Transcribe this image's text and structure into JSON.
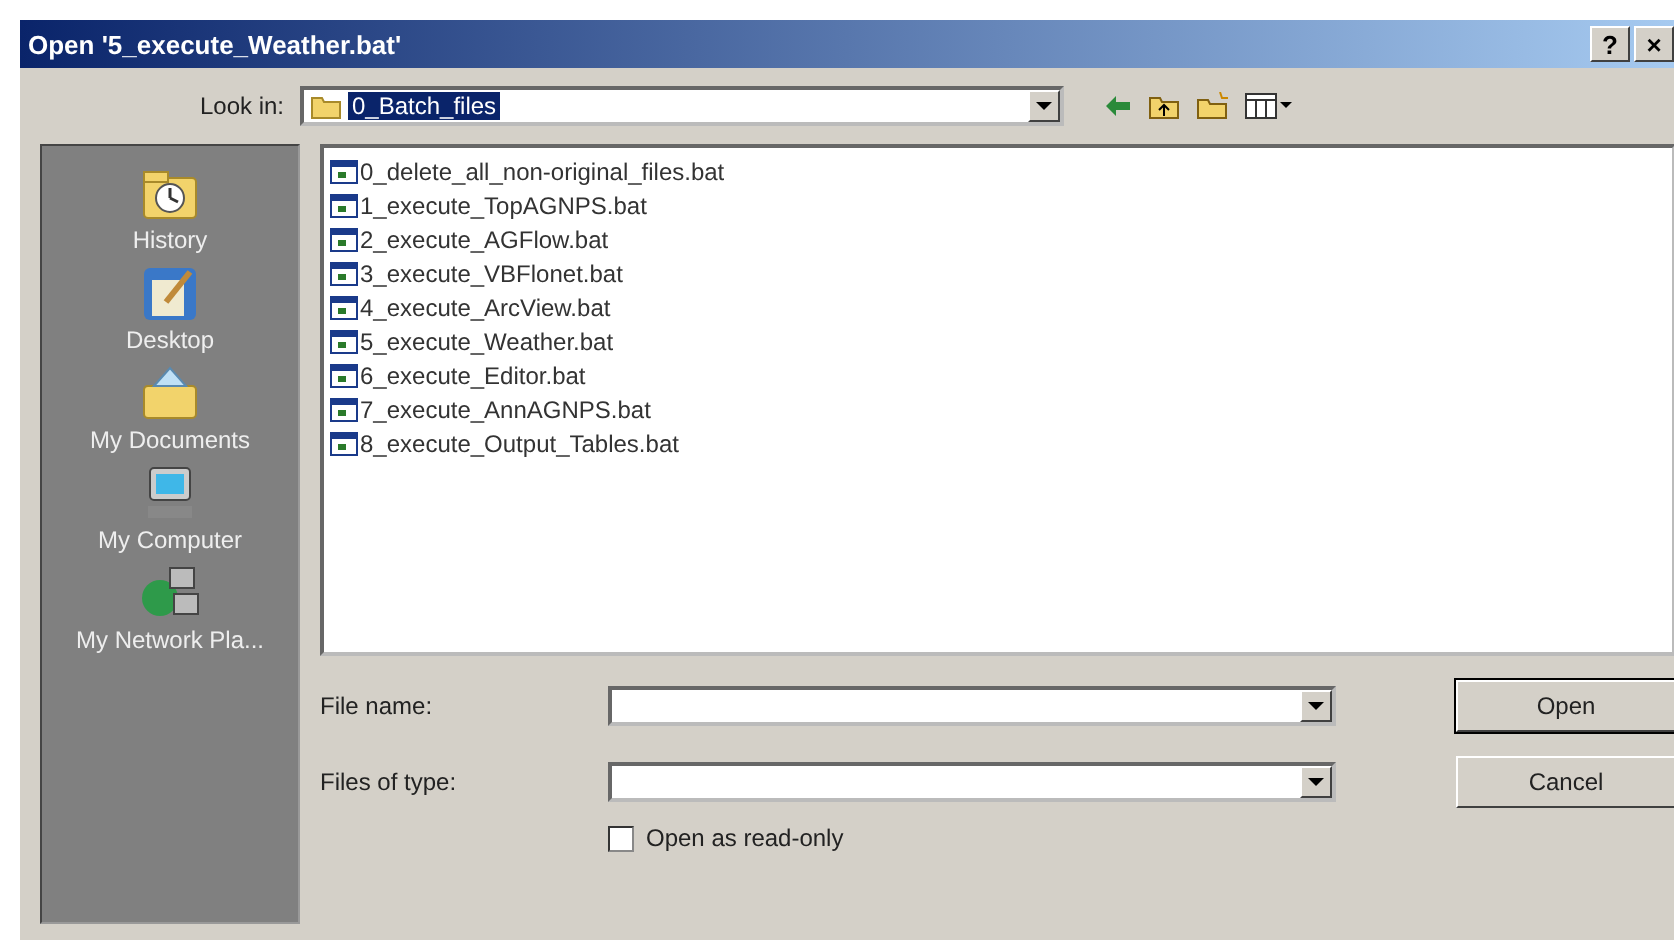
{
  "window": {
    "title": "Open '5_execute_Weather.bat'",
    "buttons": [
      "?",
      "×"
    ]
  },
  "look_in": {
    "label": "Look in:",
    "value": "0_Batch_files"
  },
  "places": [
    {
      "label": "History",
      "kind": "history"
    },
    {
      "label": "Desktop",
      "kind": "desktop"
    },
    {
      "label": "My Documents",
      "kind": "documents"
    },
    {
      "label": "My Computer",
      "kind": "computer"
    },
    {
      "label": "My Network Pla...",
      "kind": "network"
    }
  ],
  "files": [
    {
      "name": "0_delete_all_non-original_files.bat"
    },
    {
      "name": "1_execute_TopAGNPS.bat"
    },
    {
      "name": "2_execute_AGFlow.bat"
    },
    {
      "name": "3_execute_VBFlonet.bat"
    },
    {
      "name": "4_execute_ArcView.bat"
    },
    {
      "name": "5_execute_Weather.bat"
    },
    {
      "name": "6_execute_Editor.bat"
    },
    {
      "name": "7_execute_AnnAGNPS.bat"
    },
    {
      "name": "8_execute_Output_Tables.bat"
    }
  ],
  "file_name": {
    "label": "File name:"
  },
  "files_of_type": {
    "label": "Files of type:"
  },
  "read_only": {
    "label": "Open as read-only",
    "checked": false
  },
  "buttons": [
    "Open",
    "Cancel"
  ]
}
